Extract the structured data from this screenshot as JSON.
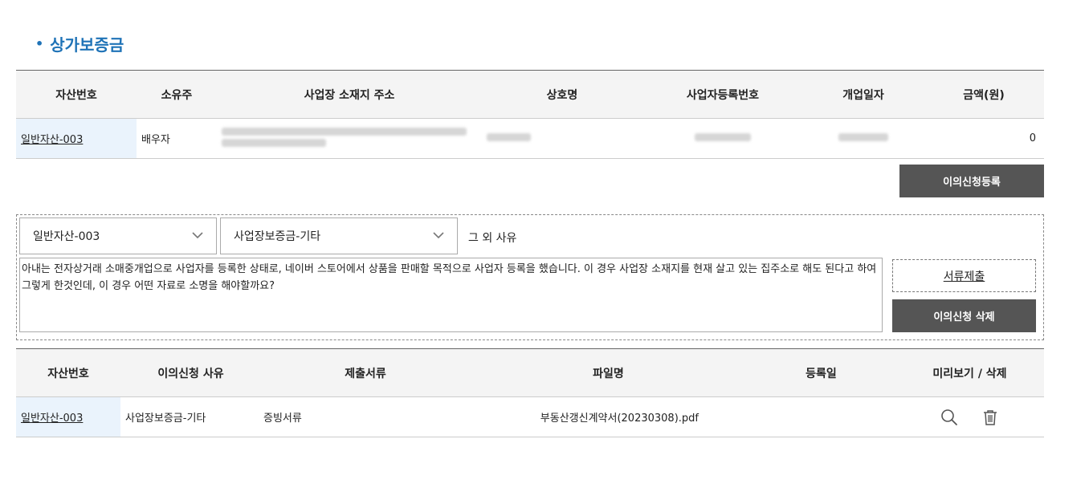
{
  "section": {
    "title": "상가보증금"
  },
  "assets_table": {
    "headers": [
      "자산번호",
      "소유주",
      "사업장 소재지 주소",
      "상호명",
      "사업자등록번호",
      "개업일자",
      "금액(원)"
    ],
    "row": {
      "asset_no": "일반자산-003",
      "owner": "배우자",
      "amount": "0"
    }
  },
  "register_button": "이의신청등록",
  "appeal_form": {
    "asset_select": "일반자산-003",
    "reason_select": "사업장보증금-기타",
    "reason_other": "그 외 사유",
    "content": "아내는 전자상거래 소매중개업으로 사업자를 등록한 상태로, 네이버 스토어에서 상품을 판매할 목적으로 사업자 등록을 했습니다. 이 경우 사업장 소재지를 현재 살고 있는 집주소로 해도 된다고 하여 그렇게 한것인데, 이 경우 어떤 자료로 소명을 해야할까요?",
    "submit_docs_button": "서류제출",
    "delete_button": "이의신청 삭제"
  },
  "documents_table": {
    "headers": [
      "자산번호",
      "이의신청 사유",
      "제출서류",
      "파일명",
      "등록일",
      "미리보기 / 삭제"
    ],
    "row": {
      "asset_no": "일반자산-003",
      "reason": "사업장보증금-기타",
      "doc_type": "증빙서류",
      "file_name": "부동산갱신계약서(20230308).pdf",
      "reg_date": ""
    }
  },
  "icons": {
    "preview": "search-icon",
    "delete": "trash-icon",
    "dropdown": "chevron-down-icon"
  },
  "colors": {
    "title": "#1f73b7",
    "button_dark": "#555555",
    "asset_cell_bg": "#eaf3fc",
    "header_bg": "#f4f4f4"
  }
}
